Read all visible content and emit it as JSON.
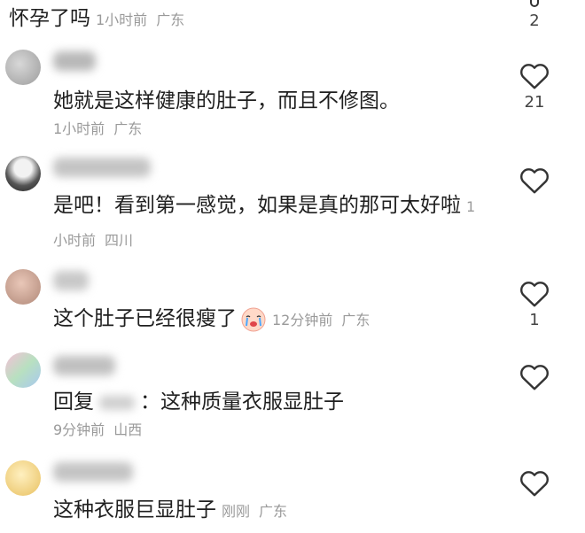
{
  "comments": [
    {
      "text": "怀孕了吗",
      "time": "1小时前",
      "location": "广东",
      "likes": "2"
    },
    {
      "text": "她就是这样健康的肚子，而且不修图。",
      "time": "1小时前",
      "location": "广东",
      "likes": "21"
    },
    {
      "text": "是吧！看到第一感觉，如果是真的那可太好啦",
      "time": "1小时前",
      "location": "四川",
      "likes": ""
    },
    {
      "text": "这个肚子已经很瘦了",
      "emoji": "crying-face-emoji",
      "time": "12分钟前",
      "location": "广东",
      "likes": "1"
    },
    {
      "reply_prefix": "回复",
      "reply_separator": "：",
      "text": "这种质量衣服显肚子",
      "time": "9分钟前",
      "location": "山西",
      "likes": ""
    },
    {
      "text": "这种衣服巨显肚子",
      "time": "刚刚",
      "location": "广东",
      "likes": ""
    }
  ],
  "icons": {
    "like": "heart-outline-icon"
  },
  "colors": {
    "meta": "#9a9a9a",
    "text": "#1f1f1f",
    "icon": "#333333"
  }
}
